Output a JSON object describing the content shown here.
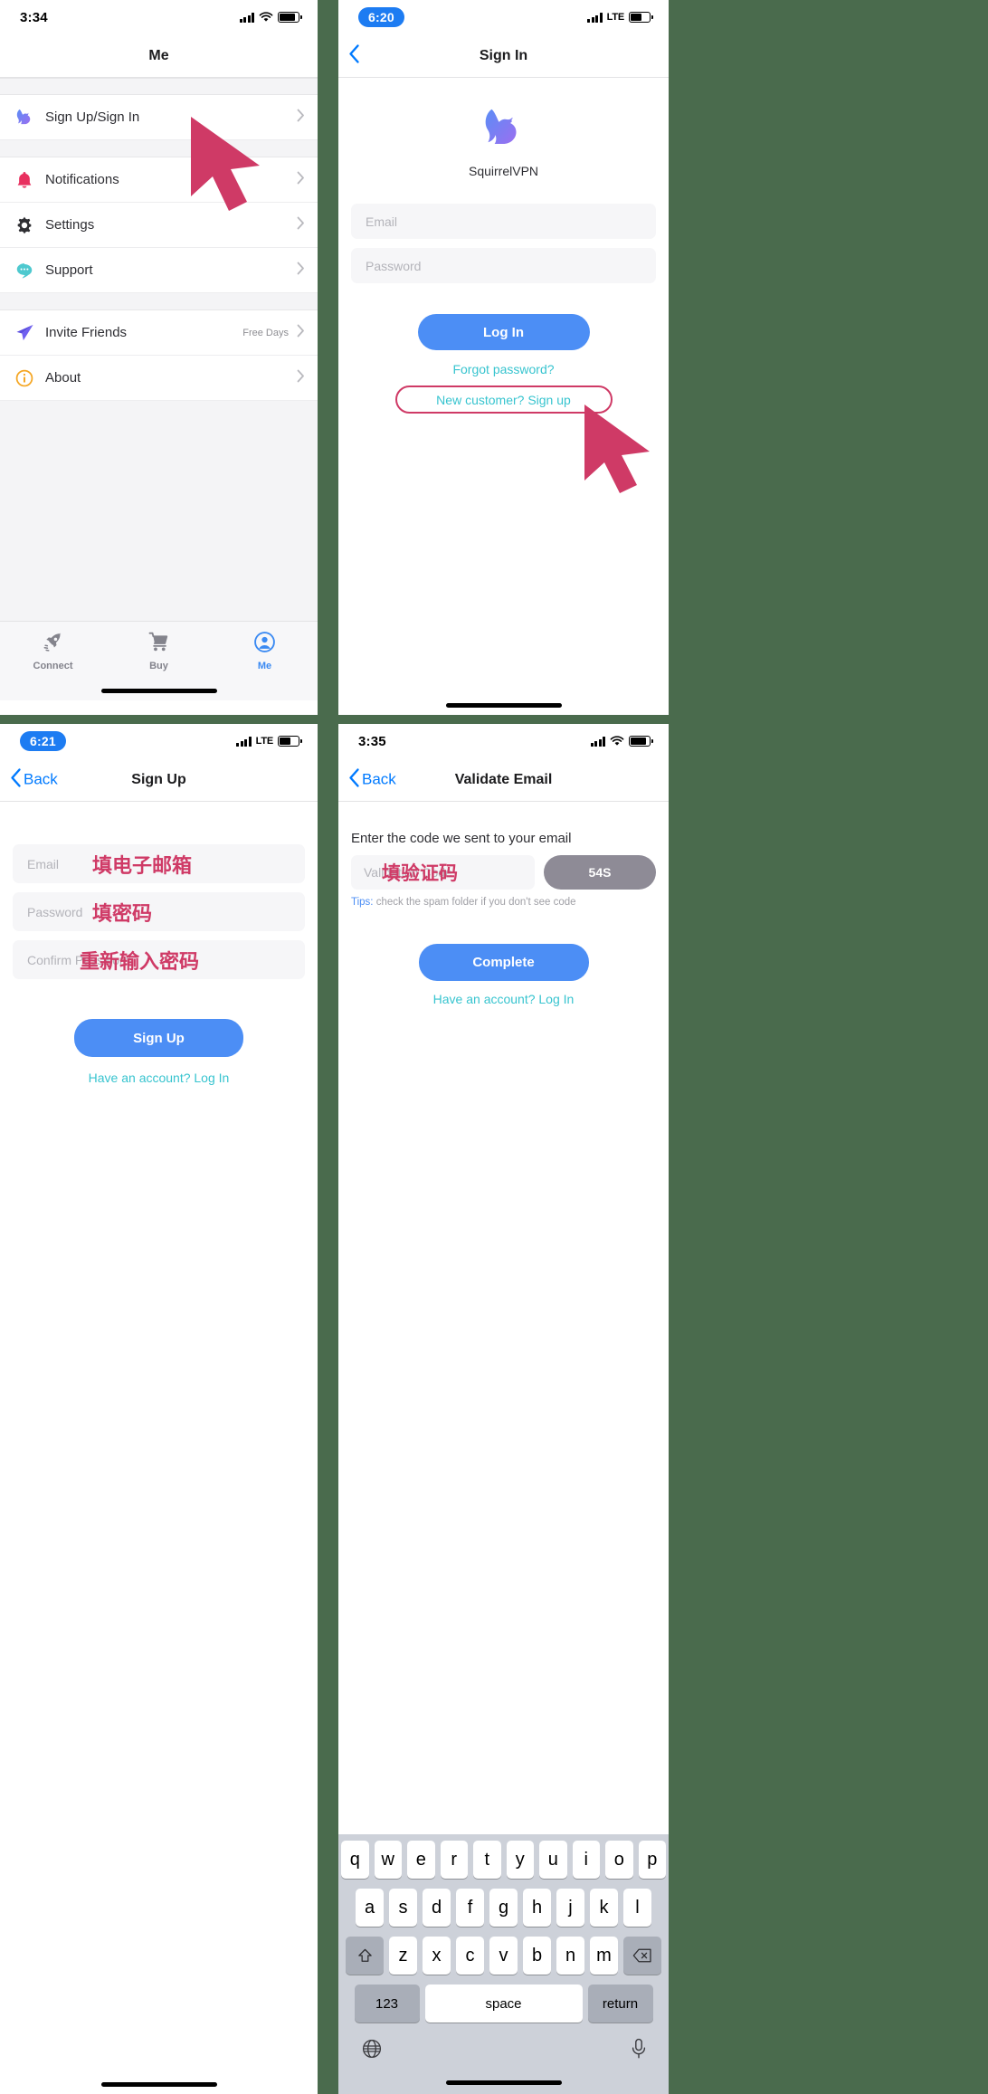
{
  "theme": {
    "backdrop": "#4a6b4d",
    "accent_blue": "#4c8ef5",
    "link_teal": "#37c4cf",
    "annotation_pink": "#cf3a66",
    "ios_blue": "#007aff"
  },
  "panel_me": {
    "status": {
      "time": "3:34",
      "carrier": "",
      "battery": "full"
    },
    "navbar": {
      "title": "Me"
    },
    "rows": [
      {
        "label": "Sign Up/Sign In",
        "icon": "squirrel-icon",
        "aux": ""
      },
      {
        "label": "Notifications",
        "icon": "bell-icon",
        "aux": ""
      },
      {
        "label": "Settings",
        "icon": "gear-icon",
        "aux": ""
      },
      {
        "label": "Support",
        "icon": "chat-bubble-icon",
        "aux": ""
      },
      {
        "label": "Invite Friends",
        "icon": "paper-plane-icon",
        "aux": "Free Days"
      },
      {
        "label": "About",
        "icon": "info-circle-icon",
        "aux": ""
      }
    ],
    "tabs": [
      {
        "label": "Connect",
        "icon": "rocket-icon",
        "active": false
      },
      {
        "label": "Buy",
        "icon": "cart-icon",
        "active": false
      },
      {
        "label": "Me",
        "icon": "person-circle-icon",
        "active": true
      }
    ]
  },
  "panel_signin": {
    "status": {
      "time": "6:20",
      "carrier": "LTE",
      "battery": "half"
    },
    "navbar": {
      "title": "Sign In",
      "back_label": ""
    },
    "brand": {
      "name": "SquirrelVPN",
      "logo": "squirrel-logo-icon"
    },
    "fields": [
      {
        "name": "email",
        "placeholder": "Email",
        "value": ""
      },
      {
        "name": "password",
        "placeholder": "Password",
        "value": ""
      }
    ],
    "login_button": "Log In",
    "forgot_link": "Forgot password?",
    "signup_link": "New customer? Sign up"
  },
  "panel_signup": {
    "status": {
      "time": "6:21",
      "carrier": "LTE",
      "battery": "half"
    },
    "navbar": {
      "title": "Sign Up",
      "back_label": "Back"
    },
    "fields": [
      {
        "name": "email",
        "placeholder": "Email",
        "note": "填电子邮箱"
      },
      {
        "name": "password",
        "placeholder": "Password",
        "note": "填密码"
      },
      {
        "name": "confirm",
        "placeholder": "Confirm Password",
        "note": "重新输入密码"
      }
    ],
    "signup_button": "Sign Up",
    "login_link": "Have an account? Log In"
  },
  "panel_validate": {
    "status": {
      "time": "3:35",
      "carrier": "",
      "battery": "full"
    },
    "navbar": {
      "title": "Validate Email",
      "back_label": "Back"
    },
    "prompt": "Enter the code we sent to your email",
    "code_field": {
      "placeholder": "Validation Code",
      "note": "填验证码"
    },
    "timer_button": "54S",
    "tips_prefix": "Tips:",
    "tips_text": " check the spam folder if you don't see code",
    "complete_button": "Complete",
    "login_link": "Have an account? Log In",
    "keyboard": {
      "row1": [
        "q",
        "w",
        "e",
        "r",
        "t",
        "y",
        "u",
        "i",
        "o",
        "p"
      ],
      "row2": [
        "a",
        "s",
        "d",
        "f",
        "g",
        "h",
        "j",
        "k",
        "l"
      ],
      "row3": [
        "z",
        "x",
        "c",
        "v",
        "b",
        "n",
        "m"
      ],
      "shift": "shift-icon",
      "backspace": "backspace-icon",
      "numbers": "123",
      "space": "space",
      "return": "return",
      "globe": "globe-icon",
      "mic": "microphone-icon"
    }
  }
}
